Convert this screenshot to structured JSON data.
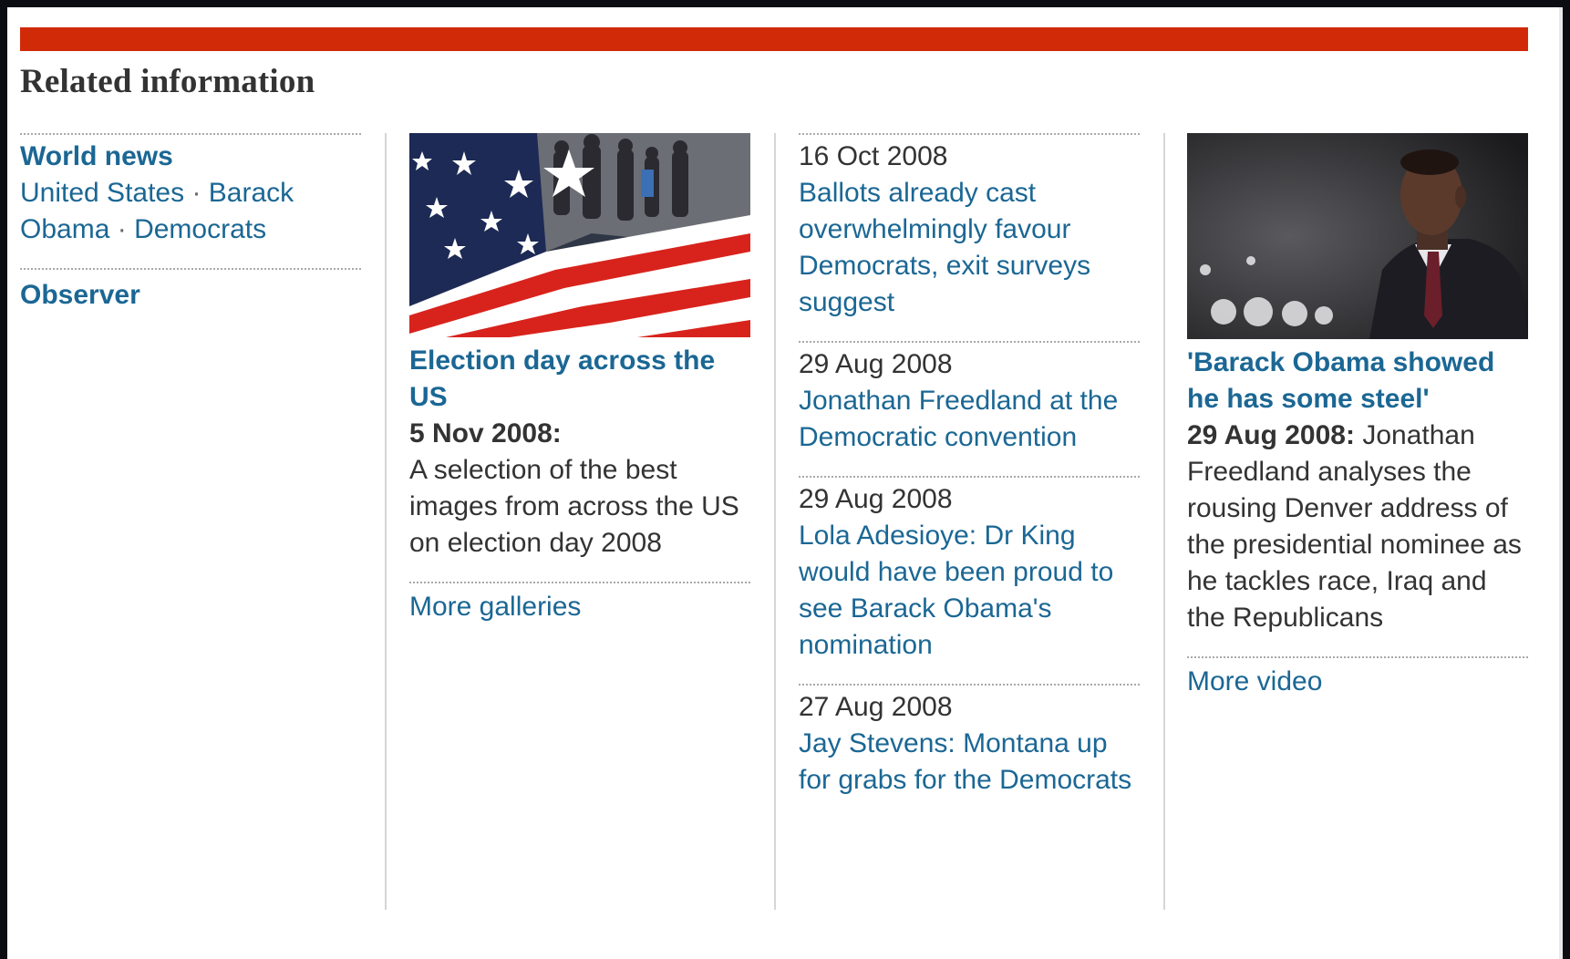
{
  "heading": "Related information",
  "sidebar": {
    "section1_title": "World news",
    "tags": [
      "United States",
      "Barack Obama",
      "Democrats"
    ],
    "tag_separator": " · ",
    "section2_title": "Observer"
  },
  "gallery": {
    "image_icon": "us-flag-voters-photo",
    "title": "Election day across the US",
    "date": "5 Nov 2008:",
    "description": "A selection of the best images from across the US on election day 2008",
    "more_link": "More galleries"
  },
  "articles": [
    {
      "date": "16 Oct 2008",
      "title": "Ballots already cast overwhelmingly favour Democrats, exit surveys suggest"
    },
    {
      "date": "29 Aug 2008",
      "title": "Jonathan Freedland at the Democratic convention"
    },
    {
      "date": "29 Aug 2008",
      "title": "Lola Adesioye: Dr King would have been proud to see Barack Obama's nomination"
    },
    {
      "date": "27 Aug 2008",
      "title": "Jay Stevens: Montana up for grabs for the Democrats"
    }
  ],
  "video": {
    "image_icon": "obama-speech-photo",
    "title": "'Barack Obama showed he has some steel'",
    "date": "29 Aug 2008:",
    "description": "Jonathan Freedland analyses the rousing Denver address of the presidential nominee as he tackles race, Iraq and the Republicans",
    "more_link": "More video"
  },
  "colors": {
    "accent_bar": "#d12a08",
    "link": "#1b6794",
    "text": "#333333",
    "frame": "#0b0d13"
  }
}
